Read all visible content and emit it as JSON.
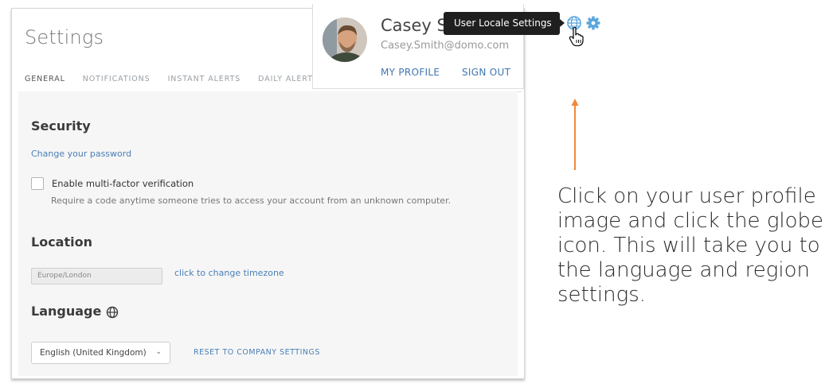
{
  "settings": {
    "title": "Settings",
    "tabs": [
      {
        "label": "GENERAL"
      },
      {
        "label": "NOTIFICATIONS"
      },
      {
        "label": "INSTANT ALERTS"
      },
      {
        "label": "DAILY ALERT"
      }
    ],
    "security": {
      "heading": "Security",
      "change_password": "Change your password",
      "mfa_label": "Enable multi-factor verification",
      "mfa_checked": false,
      "mfa_help": "Require a code anytime someone tries to access your account from an unknown computer."
    },
    "location": {
      "heading": "Location",
      "timezone_value": "Europe/London",
      "change_timezone": "click to change timezone"
    },
    "language": {
      "heading": "Language",
      "icon": "globe-icon",
      "selected": "English (United Kingdom)",
      "reset": "RESET TO COMPANY SETTINGS"
    }
  },
  "profile": {
    "name": "Casey Sr",
    "email": "Casey.Smith@domo.com",
    "my_profile": "MY PROFILE",
    "sign_out": "SIGN OUT"
  },
  "tooltip": "User Locale Settings",
  "icons": {
    "globe": "globe-icon",
    "gear": "gear-icon",
    "cursor": "hand-pointer-icon"
  },
  "colors": {
    "accent": "#4a7fb5",
    "icon_blue": "#5aa5de",
    "arrow": "#f0883e"
  },
  "instruction": "Click on your user profile image and click the globe icon. This will take you to the language and region settings."
}
